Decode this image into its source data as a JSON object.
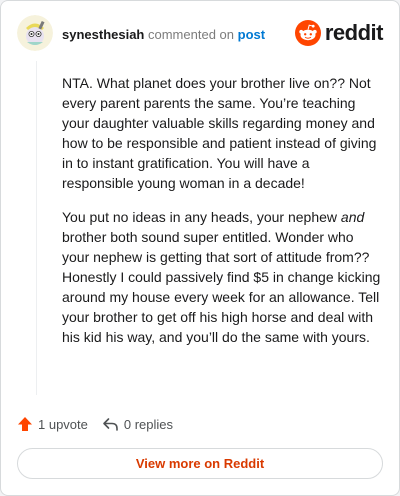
{
  "header": {
    "username": "synesthesiah",
    "action_text": "commented on",
    "target_text": "post",
    "brand_name": "reddit",
    "brand_color": "#ff4500"
  },
  "comment": {
    "paragraph_1": "NTA. What planet does your brother live on?? Not every parent parents the same. You’re teaching your daughter valuable skills regarding money and how to be responsible and patient instead of giving in to instant gratification. You will have a responsible young woman in a decade!",
    "paragraph_2_a": "You put no ideas in any heads, your nephew ",
    "paragraph_2_em": "and",
    "paragraph_2_b": " brother both sound super entitled. Wonder who your nephew is getting that sort of attitude from?? Honestly I could passively find $5 in change kicking around my house every week for an allowance. Tell your brother to get off his high horse and deal with his kid his way, and you’ll do the same with yours."
  },
  "footer": {
    "upvotes": "1 upvote",
    "replies": "0 replies",
    "view_more": "View more on Reddit"
  },
  "icons": {
    "upvote": "upvote-arrow-icon",
    "reply": "reply-arrow-icon",
    "brand": "reddit-snoo-icon",
    "avatar": "user-avatar"
  }
}
